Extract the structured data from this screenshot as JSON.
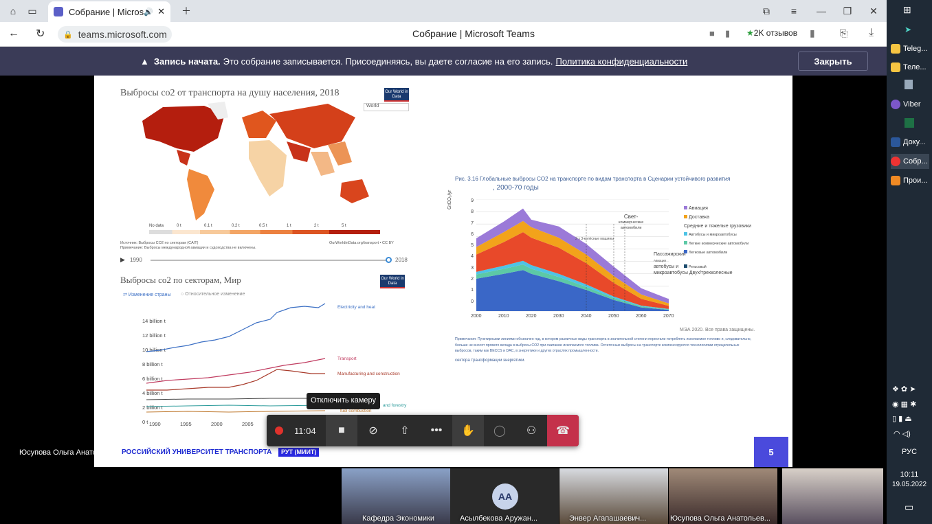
{
  "browser": {
    "tab_title": "Собрание | Microsof",
    "url": "teams.microsoft.com",
    "page_title": "Собрание | Microsoft Teams",
    "reviews": "2K отзывов"
  },
  "banner": {
    "bold": "Запись начата.",
    "text": "Это собрание записывается. Присоединяясь, вы даете согласие на его запись.",
    "link": "Политика конфиденциальности",
    "close": "Закрыть"
  },
  "slide": {
    "map": {
      "title": "Выбросы co2 от транспорта на душу населения, 2018",
      "logo": "Our World in Data",
      "select": "World",
      "legend": [
        "No data",
        "0 t",
        "0.1 t",
        "0.2 t",
        "0.5 t",
        "1 t",
        "2 t",
        "5 t"
      ],
      "source": "Источник: Выбросы CO2 по секторам (CAIT)",
      "note": "Примечание: Выбросы международной авиации и судоходства не включены.",
      "credit": "OurWorldinData.org/transport • CC BY",
      "year_start": "1990",
      "year_end": "2018"
    },
    "sector_chart": {
      "title": "Выбросы co2 по секторам, Мир",
      "logo": "Our World in Data",
      "tab1": "Изменение страны",
      "tab2": "Относительное изменение",
      "y_ticks": [
        "14 billion t",
        "12 billion t",
        "10 billion t",
        "8 billion t",
        "6 billion t",
        "4 billion t",
        "2 billion t",
        "0 t"
      ],
      "x_ticks": [
        "1990",
        "1995",
        "2000",
        "2005"
      ],
      "labels": [
        "Electricity and heat",
        "Transport",
        "Manufacturing and construction",
        "and forestry",
        "fuel combustion"
      ]
    },
    "iea_chart": {
      "title": "Рис. 3.16 Глобальные выбросы CO2 на транспорте по видам транспорта в Сценарии устойчивого развития",
      "subtitle": ", 2000-70 годы",
      "ylabel": "GtCO₂/yr",
      "y_ticks": [
        "9",
        "8",
        "7",
        "6",
        "5",
        "4",
        "3",
        "2",
        "1",
        "0"
      ],
      "x_ticks": [
        "2000",
        "2010",
        "2020",
        "2030",
        "2040",
        "2050",
        "2060",
        "2070"
      ],
      "annot": [
        "Свет-",
        "коммерческие",
        "автомобили",
        "2-х 3-колёсные машины",
        "Пассажирский",
        "Авиация",
        "автобусы и",
        "микроавтобусы Двух/трехколесные"
      ],
      "legend": [
        "Авиация",
        "Доставка",
        "Средние и тяжелые грузовики",
        "Автобусы и микроавтобусы",
        "Легкие коммерческие автомобили",
        "Легковые автомобили",
        "Рельсовый"
      ],
      "rights": "МЭА 2020. Все права защищены.",
      "note": "Примечания: Пунктирными линиями обозначен год, в котором различные виды транспорта в значительной степени перестали потреблять ископаемое топливо и, следовательно, больше не вносят прямого вклада в выбросы CO2 при сжигании ископаемого топлива. Остаточные выбросы на транспорте компенсируются технологиями отрицательных выбросов, таким как BECCS и DAC, в энергетике и других отраслях промышленности.",
      "note2": "сектора трансформации энергетики."
    },
    "university": "РОССИЙСКИЙ УНИВЕРСИТЕТ ТРАНСПОРТА",
    "univ_badge": "РУТ (МИИТ)",
    "page_number": "5"
  },
  "presenter_name": "Юсупова Ольга Анатольевна",
  "tooltip": "Отключить камеру",
  "controls": {
    "timer": "11:04"
  },
  "gallery": [
    {
      "name": "Кафедра Экономики"
    },
    {
      "name": "Асылбекова Аружан...",
      "initials": "АА"
    },
    {
      "name": "Энвер Агапашаевич..."
    },
    {
      "name": "Юсупова Ольга Анатольев..."
    }
  ],
  "taskbar": {
    "items": [
      "Teleg...",
      "Теле...",
      "Viber",
      "Доку...",
      "Собр...",
      "Прои..."
    ],
    "lang": "РУС",
    "time": "10:11",
    "date": "19.05.2022"
  },
  "chart_data": {
    "type": "area",
    "title": "Рис. 3.16 Глобальные выбросы CO2 на транспорте по видам транспорта в Сценарии устойчивого развития",
    "x": [
      2000,
      2010,
      2017,
      2020,
      2030,
      2040,
      2050,
      2060,
      2070
    ],
    "ylim": [
      0,
      9
    ],
    "series": [
      {
        "name": "Легковые автомобили",
        "color": "#3a67c7",
        "values": [
          2.6,
          3.0,
          3.3,
          3.0,
          2.4,
          1.7,
          0.9,
          0.3,
          0.1
        ]
      },
      {
        "name": "Легкие коммерческие автомобили",
        "color": "#5cc9a6",
        "values": [
          0.35,
          0.4,
          0.45,
          0.4,
          0.35,
          0.25,
          0.15,
          0.08,
          0.04
        ]
      },
      {
        "name": "Автобусы и микроавтобусы",
        "color": "#4ec3e6",
        "values": [
          0.2,
          0.25,
          0.3,
          0.3,
          0.25,
          0.2,
          0.12,
          0.06,
          0.03
        ]
      },
      {
        "name": "Средние и тяжелые грузовики",
        "color": "#e8492a",
        "values": [
          1.4,
          1.9,
          2.3,
          2.2,
          2.1,
          1.7,
          1.1,
          0.55,
          0.25
        ]
      },
      {
        "name": "Доставка",
        "color": "#f2a31b",
        "values": [
          0.6,
          0.8,
          0.9,
          0.85,
          0.8,
          0.7,
          0.55,
          0.35,
          0.2
        ]
      },
      {
        "name": "Авиация",
        "color": "#9b7ad8",
        "values": [
          0.7,
          0.85,
          1.0,
          0.6,
          0.9,
          0.85,
          0.75,
          0.5,
          0.35
        ]
      }
    ]
  }
}
